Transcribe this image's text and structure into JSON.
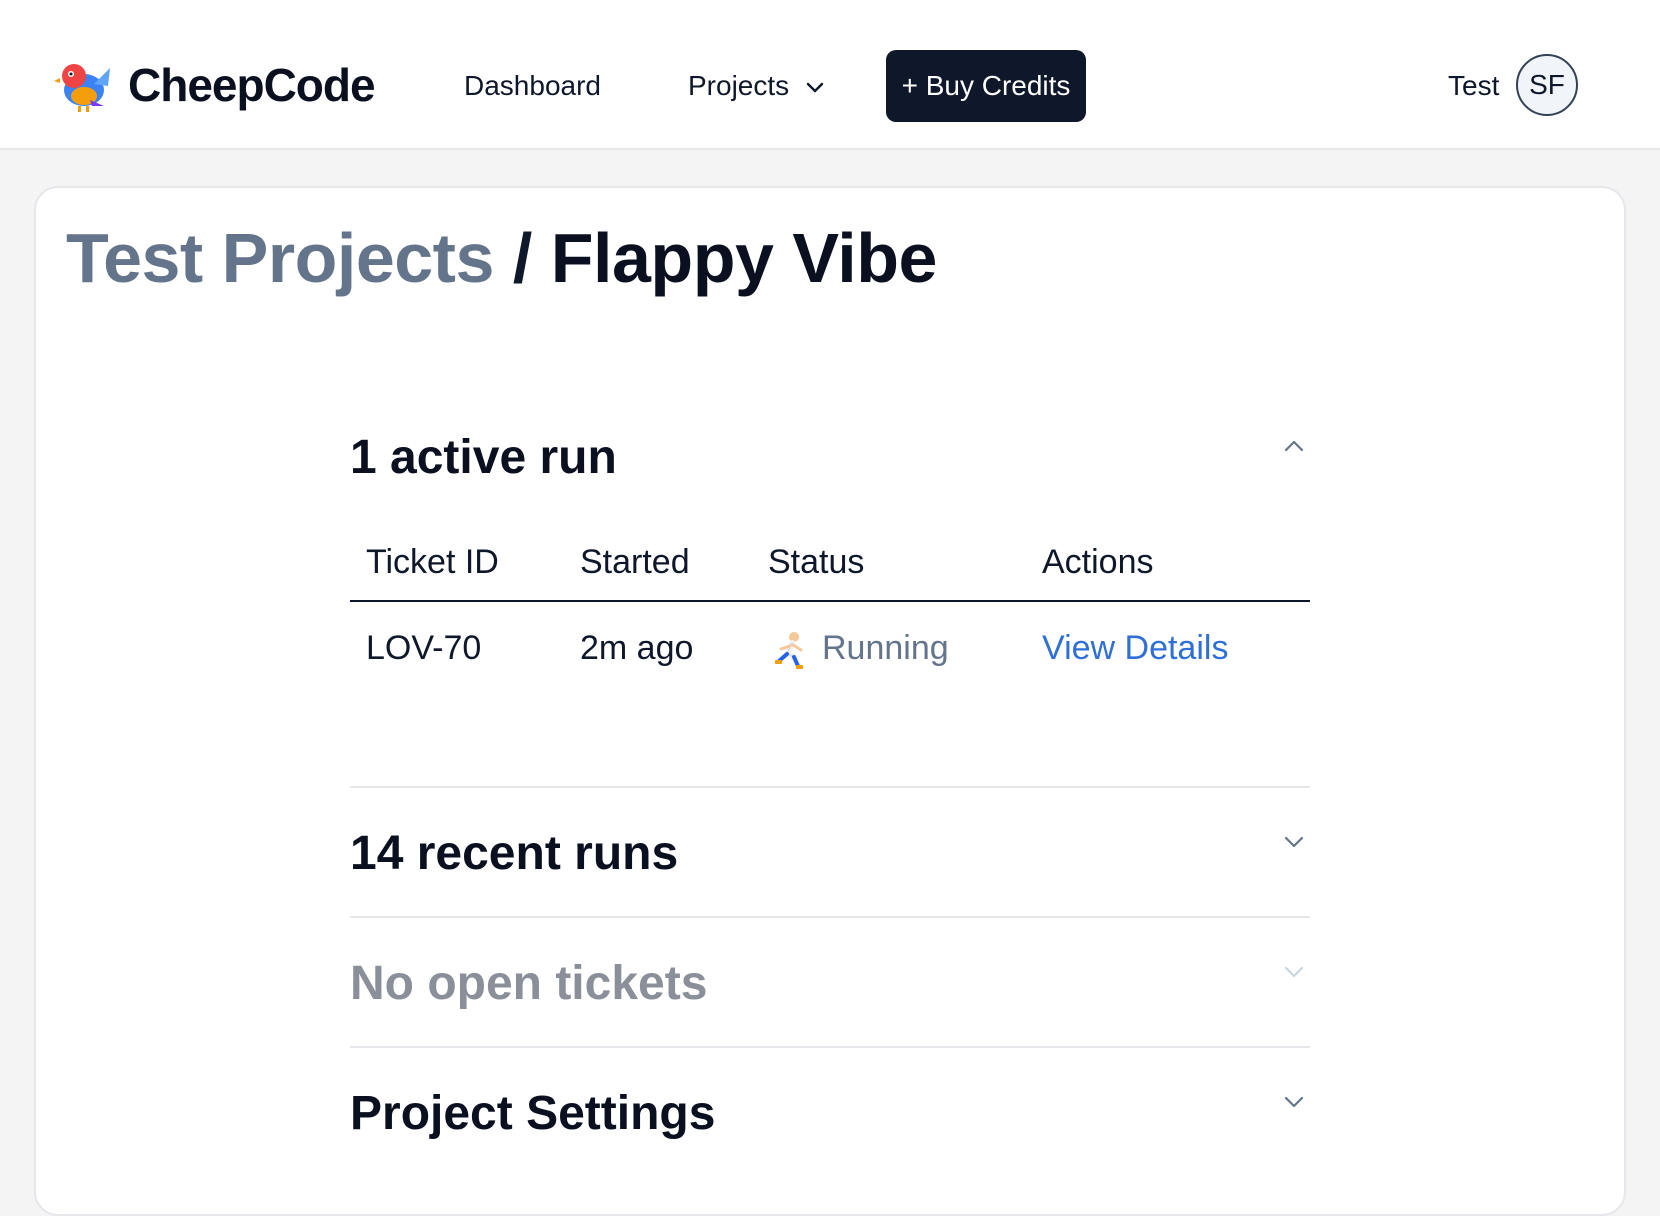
{
  "header": {
    "brand": "CheepCode",
    "nav": {
      "dashboard": "Dashboard",
      "projects": "Projects"
    },
    "buy_credits": "+ Buy Credits",
    "user_name": "Test",
    "avatar_initials": "SF"
  },
  "breadcrumb": {
    "parent": "Test Projects",
    "separator": " / ",
    "current": "Flappy Vibe"
  },
  "sections": {
    "active_runs": {
      "title": "1 active run",
      "expanded": true,
      "columns": [
        "Ticket ID",
        "Started",
        "Status",
        "Actions"
      ],
      "rows": [
        {
          "ticket_id": "LOV-70",
          "started": "2m ago",
          "status": "Running",
          "status_icon": "runner-icon",
          "action": "View Details"
        }
      ]
    },
    "recent_runs": {
      "title": "14 recent runs",
      "expanded": false
    },
    "open_tickets": {
      "title": "No open tickets",
      "expanded": false
    },
    "project_settings": {
      "title": "Project Settings",
      "expanded": false
    }
  },
  "colors": {
    "primary": "#0f172a",
    "muted": "#64748b",
    "link": "#2f6fd6",
    "page_background": "#f4f4f5"
  }
}
